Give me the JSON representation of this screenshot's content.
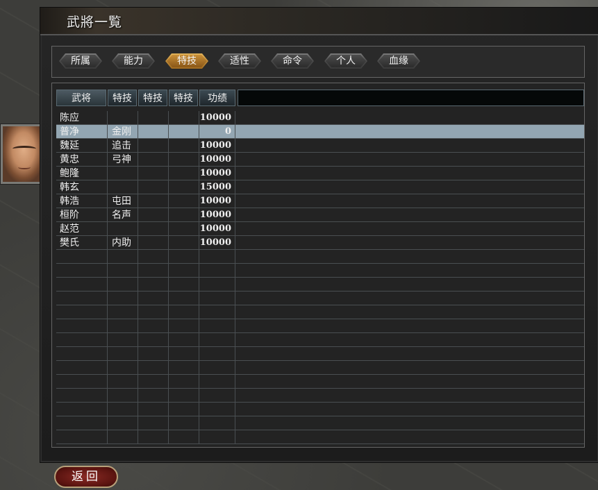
{
  "window": {
    "title": "武將一覧"
  },
  "tabs": [
    {
      "label": "所属",
      "active": false
    },
    {
      "label": "能力",
      "active": false
    },
    {
      "label": "特技",
      "active": true
    },
    {
      "label": "适性",
      "active": false
    },
    {
      "label": "命令",
      "active": false
    },
    {
      "label": "个人",
      "active": false
    },
    {
      "label": "血缘",
      "active": false
    }
  ],
  "table": {
    "headers": [
      "武将",
      "特技",
      "特技",
      "特技",
      "功绩"
    ],
    "rows": [
      {
        "name": "陈应",
        "skill1": "",
        "skill2": "",
        "skill3": "",
        "merit": "10000",
        "selected": false
      },
      {
        "name": "普净",
        "skill1": "金刚",
        "skill2": "",
        "skill3": "",
        "merit": "0",
        "selected": true
      },
      {
        "name": "魏延",
        "skill1": "追击",
        "skill2": "",
        "skill3": "",
        "merit": "10000",
        "selected": false
      },
      {
        "name": "黄忠",
        "skill1": "弓神",
        "skill2": "",
        "skill3": "",
        "merit": "10000",
        "selected": false
      },
      {
        "name": "鲍隆",
        "skill1": "",
        "skill2": "",
        "skill3": "",
        "merit": "10000",
        "selected": false
      },
      {
        "name": "韩玄",
        "skill1": "",
        "skill2": "",
        "skill3": "",
        "merit": "15000",
        "selected": false
      },
      {
        "name": "韩浩",
        "skill1": "屯田",
        "skill2": "",
        "skill3": "",
        "merit": "10000",
        "selected": false
      },
      {
        "name": "桓阶",
        "skill1": "名声",
        "skill2": "",
        "skill3": "",
        "merit": "10000",
        "selected": false
      },
      {
        "name": "赵范",
        "skill1": "",
        "skill2": "",
        "skill3": "",
        "merit": "10000",
        "selected": false
      },
      {
        "name": "樊氏",
        "skill1": "内助",
        "skill2": "",
        "skill3": "",
        "merit": "10000",
        "selected": false
      }
    ],
    "total_row_slots": 24
  },
  "back_button": {
    "label": "返回"
  },
  "colors": {
    "selected_row": "#93a6b2",
    "active_tab": "#c98f38",
    "back_button": "#8a2a24"
  }
}
